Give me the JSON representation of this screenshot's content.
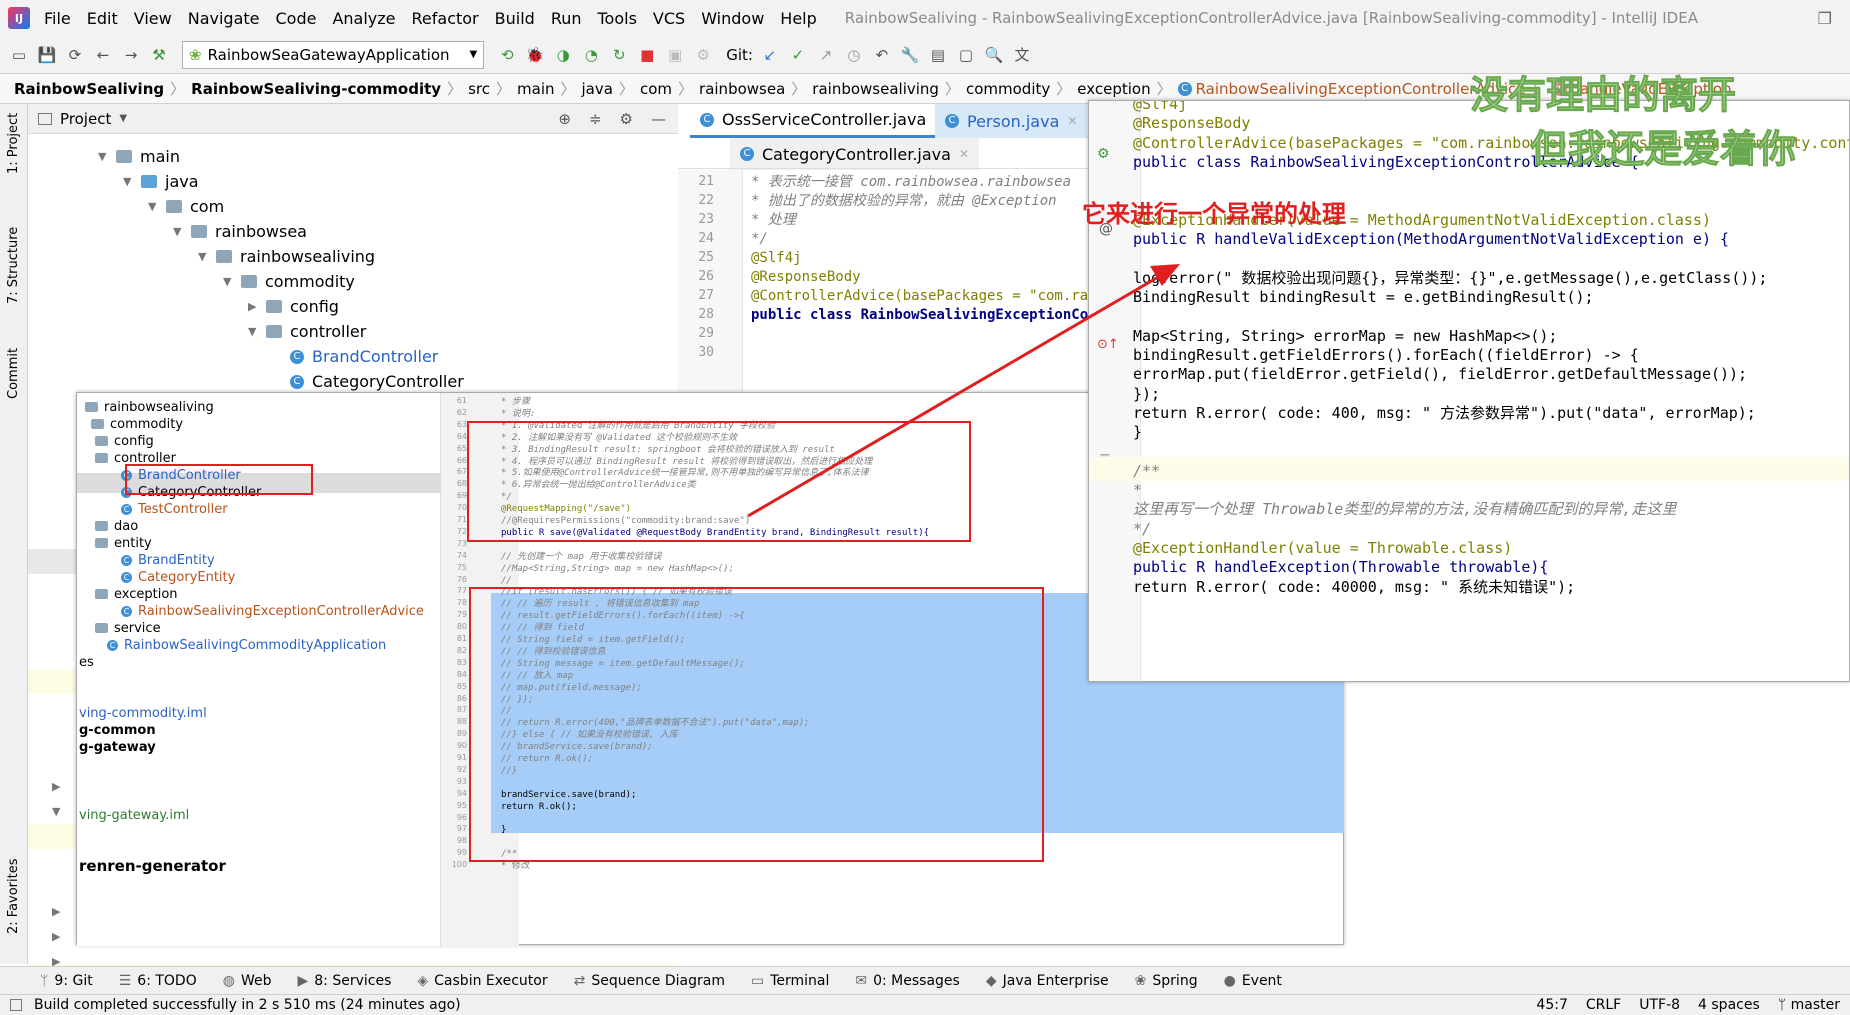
{
  "menu": [
    "File",
    "Edit",
    "View",
    "Navigate",
    "Code",
    "Analyze",
    "Refactor",
    "Build",
    "Run",
    "Tools",
    "VCS",
    "Window",
    "Help"
  ],
  "window_title": "RainbowSealiving - RainbowSealivingExceptionControllerAdvice.java [RainbowSealiving-commodity] - IntelliJ IDEA",
  "toolbar": {
    "run_config": "RainbowSeaGatewayApplication",
    "git_label": "Git:"
  },
  "breadcrumb": [
    "RainbowSealiving",
    "RainbowSealiving-commodity",
    "src",
    "main",
    "java",
    "com",
    "rainbowsea",
    "rainbowsealiving",
    "commodity",
    "exception",
    "RainbowSealivingExceptionControllerAdvice",
    "handleValidException"
  ],
  "project_panel": {
    "title": "Project",
    "items": [
      "main",
      "java",
      "com",
      "rainbowsea",
      "rainbowsealiving",
      "commodity",
      "config",
      "controller",
      "BrandController",
      "CategoryController"
    ]
  },
  "editor_tabs": [
    "OssServiceController.java",
    "Person.java",
    "CategoryController.java"
  ],
  "code_main": {
    "lines": [
      {
        "n": "21",
        "t": "*    表示统一接管 com.rainbowsea.rainbowsea"
      },
      {
        "n": "22",
        "t": "*    抛出了的数据校验的异常，就由  @Exception"
      },
      {
        "n": "23",
        "t": "*    处理"
      },
      {
        "n": "24",
        "t": "*/"
      },
      {
        "n": "25",
        "t": "@Slf4j"
      },
      {
        "n": "26",
        "t": "@ResponseBody"
      },
      {
        "n": "27",
        "t": "@ControllerAdvice(basePackages = \"com.rain"
      },
      {
        "n": "28",
        "t": "public class RainbowSealivingExceptionContr"
      },
      {
        "n": "29",
        "t": ""
      },
      {
        "n": "30",
        "t": ""
      }
    ]
  },
  "overlay_tree": {
    "items": [
      "rainbowsealiving",
      "commodity",
      "config",
      "controller",
      "BrandController",
      "CategoryController",
      "TestController",
      "dao",
      "entity",
      "BrandEntity",
      "CategoryEntity",
      "exception",
      "RainbowSealivingExceptionControllerAdvice",
      "service",
      "RainbowSealivingCommodityApplication",
      "es",
      "ving-commodity.iml",
      "g-common",
      "g-gateway",
      "ving-gateway.iml",
      "renren-generator"
    ]
  },
  "overlay_code": {
    "lines": [
      {
        "n": "61",
        "t": "* 步骤"
      },
      {
        "n": "62",
        "t": "* 说明:"
      },
      {
        "n": "63",
        "t": "* 1. @Validated 注解的作用就是启用 BrandEntity 字段校验"
      },
      {
        "n": "64",
        "t": "* 2. 注解如果没有写 @Validated 这个校验规则不生效"
      },
      {
        "n": "65",
        "t": "* 3. BindingResult result: springboot 会将校验的错误放入到 result"
      },
      {
        "n": "66",
        "t": "* 4. 程序员可以通过 BindingResult result 将校验得到错误取出，然后进行相应处理"
      },
      {
        "n": "67",
        "t": "* 5.如果使用@ControllerAdvice统一接管异常,则不用单独的编写异常信息了,体系法律"
      },
      {
        "n": "68",
        "t": "* 6.异常会统一抛出给@ControllerAdvice类"
      },
      {
        "n": "69",
        "t": "*/"
      },
      {
        "n": "70",
        "t": "@RequestMapping(\"/save\")"
      },
      {
        "n": "71",
        "t": "//@RequiresPermissions(\"commodity:brand:save\")"
      },
      {
        "n": "72",
        "t": "public R save(@Validated @RequestBody BrandEntity brand, BindingResult result){"
      },
      {
        "n": "73",
        "t": ""
      },
      {
        "n": "74",
        "t": "    // 先创建一个 map 用于收集校验错误"
      },
      {
        "n": "75",
        "t": "    //Map<String,String> map = new HashMap<>();"
      },
      {
        "n": "76",
        "t": "    //"
      },
      {
        "n": "77",
        "t": "    //if (result.hasErrors()) {  // 如果有校验错误"
      },
      {
        "n": "78",
        "t": "    //    // 遍历 result , 将错误信息收集到 map"
      },
      {
        "n": "79",
        "t": "    //    result.getFieldErrors().forEach((item) ->{"
      },
      {
        "n": "80",
        "t": "    //        // 得到 field"
      },
      {
        "n": "81",
        "t": "    //        String field = item.getField();"
      },
      {
        "n": "82",
        "t": "    //        // 得到校验错误信息"
      },
      {
        "n": "83",
        "t": "    //        String message = item.getDefaultMessage();"
      },
      {
        "n": "84",
        "t": "    //        // 放入 map"
      },
      {
        "n": "85",
        "t": "    //        map.put(field,message);"
      },
      {
        "n": "86",
        "t": "    //    });"
      },
      {
        "n": "87",
        "t": "    //"
      },
      {
        "n": "88",
        "t": "    //    return R.error(400,\"品牌表单数据不合法\").put(\"data\",map);"
      },
      {
        "n": "89",
        "t": "    //} else { // 如果没有校验错误, 入库"
      },
      {
        "n": "90",
        "t": "    //    brandService.save(brand);"
      },
      {
        "n": "91",
        "t": "    //    return R.ok();"
      },
      {
        "n": "92",
        "t": "    //}"
      },
      {
        "n": "93",
        "t": ""
      },
      {
        "n": "94",
        "t": "    brandService.save(brand);"
      },
      {
        "n": "95",
        "t": "    return R.ok();"
      },
      {
        "n": "96",
        "t": ""
      },
      {
        "n": "97",
        "t": "}"
      },
      {
        "n": "98",
        "t": ""
      },
      {
        "n": "99",
        "t": "/**"
      },
      {
        "n": "100",
        "t": " * 修改"
      }
    ]
  },
  "popup_code": {
    "lines": [
      "@Slf4j",
      "@ResponseBody",
      "@ControllerAdvice(basePackages = \"com.rainbowsea.rainbowsealiving.commodity.controller\")",
      "public class RainbowSealivingExceptionControllerAdvice {",
      "",
      "",
      "    @ExceptionHandler(value = MethodArgumentNotValidException.class)",
      "    public R handleValidException(MethodArgumentNotValidException e) {",
      "",
      "        log.error(\" 数据校验出现问题{}，异常类型：{}\",e.getMessage(),e.getClass());",
      "        BindingResult bindingResult = e.getBindingResult();",
      "",
      "        Map<String, String> errorMap = new HashMap<>();",
      "        bindingResult.getFieldErrors().forEach((fieldError) -> {",
      "            errorMap.put(fieldError.getField(), fieldError.getDefaultMessage());",
      "        });",
      "        return R.error( code: 400,  msg: \" 方法参数异常\").put(\"data\", errorMap);",
      "    }",
      "",
      "    /**",
      "     *",
      "     这里再写一个处理 Throwable类型的异常的方法,没有精确匹配到的异常,走这里",
      "     */",
      "    @ExceptionHandler(value = Throwable.class)",
      "    public R handleException(Throwable throwable){",
      "        return R.error( code: 40000, msg: \" 系统未知错误\");"
    ]
  },
  "annotation_text": "它来进行一个异常的处理",
  "watermark": {
    "line1": "没有理由的离开",
    "line2": "但我还是爱着你"
  },
  "side_tabs": {
    "project": "1: Project",
    "structure": "7: Structure",
    "commit": "Commit",
    "favorites": "2: Favorites"
  },
  "bottom_tabs": [
    "9: Git",
    "6: TODO",
    "Web",
    "8: Services",
    "Casbin Executor",
    "Sequence Diagram",
    "Terminal",
    "0: Messages",
    "Java Enterprise",
    "Spring",
    "Event"
  ],
  "status": {
    "message": "Build completed successfully in 2 s 510 ms (24 minutes ago)",
    "position": "45:7",
    "line_sep": "CRLF",
    "encoding": "UTF-8",
    "indent": "4 spaces",
    "branch": "master"
  },
  "colors": {
    "annotation_red": "#e02020",
    "selection": "#a6cdf7",
    "watermark": "#b7e6a5"
  }
}
